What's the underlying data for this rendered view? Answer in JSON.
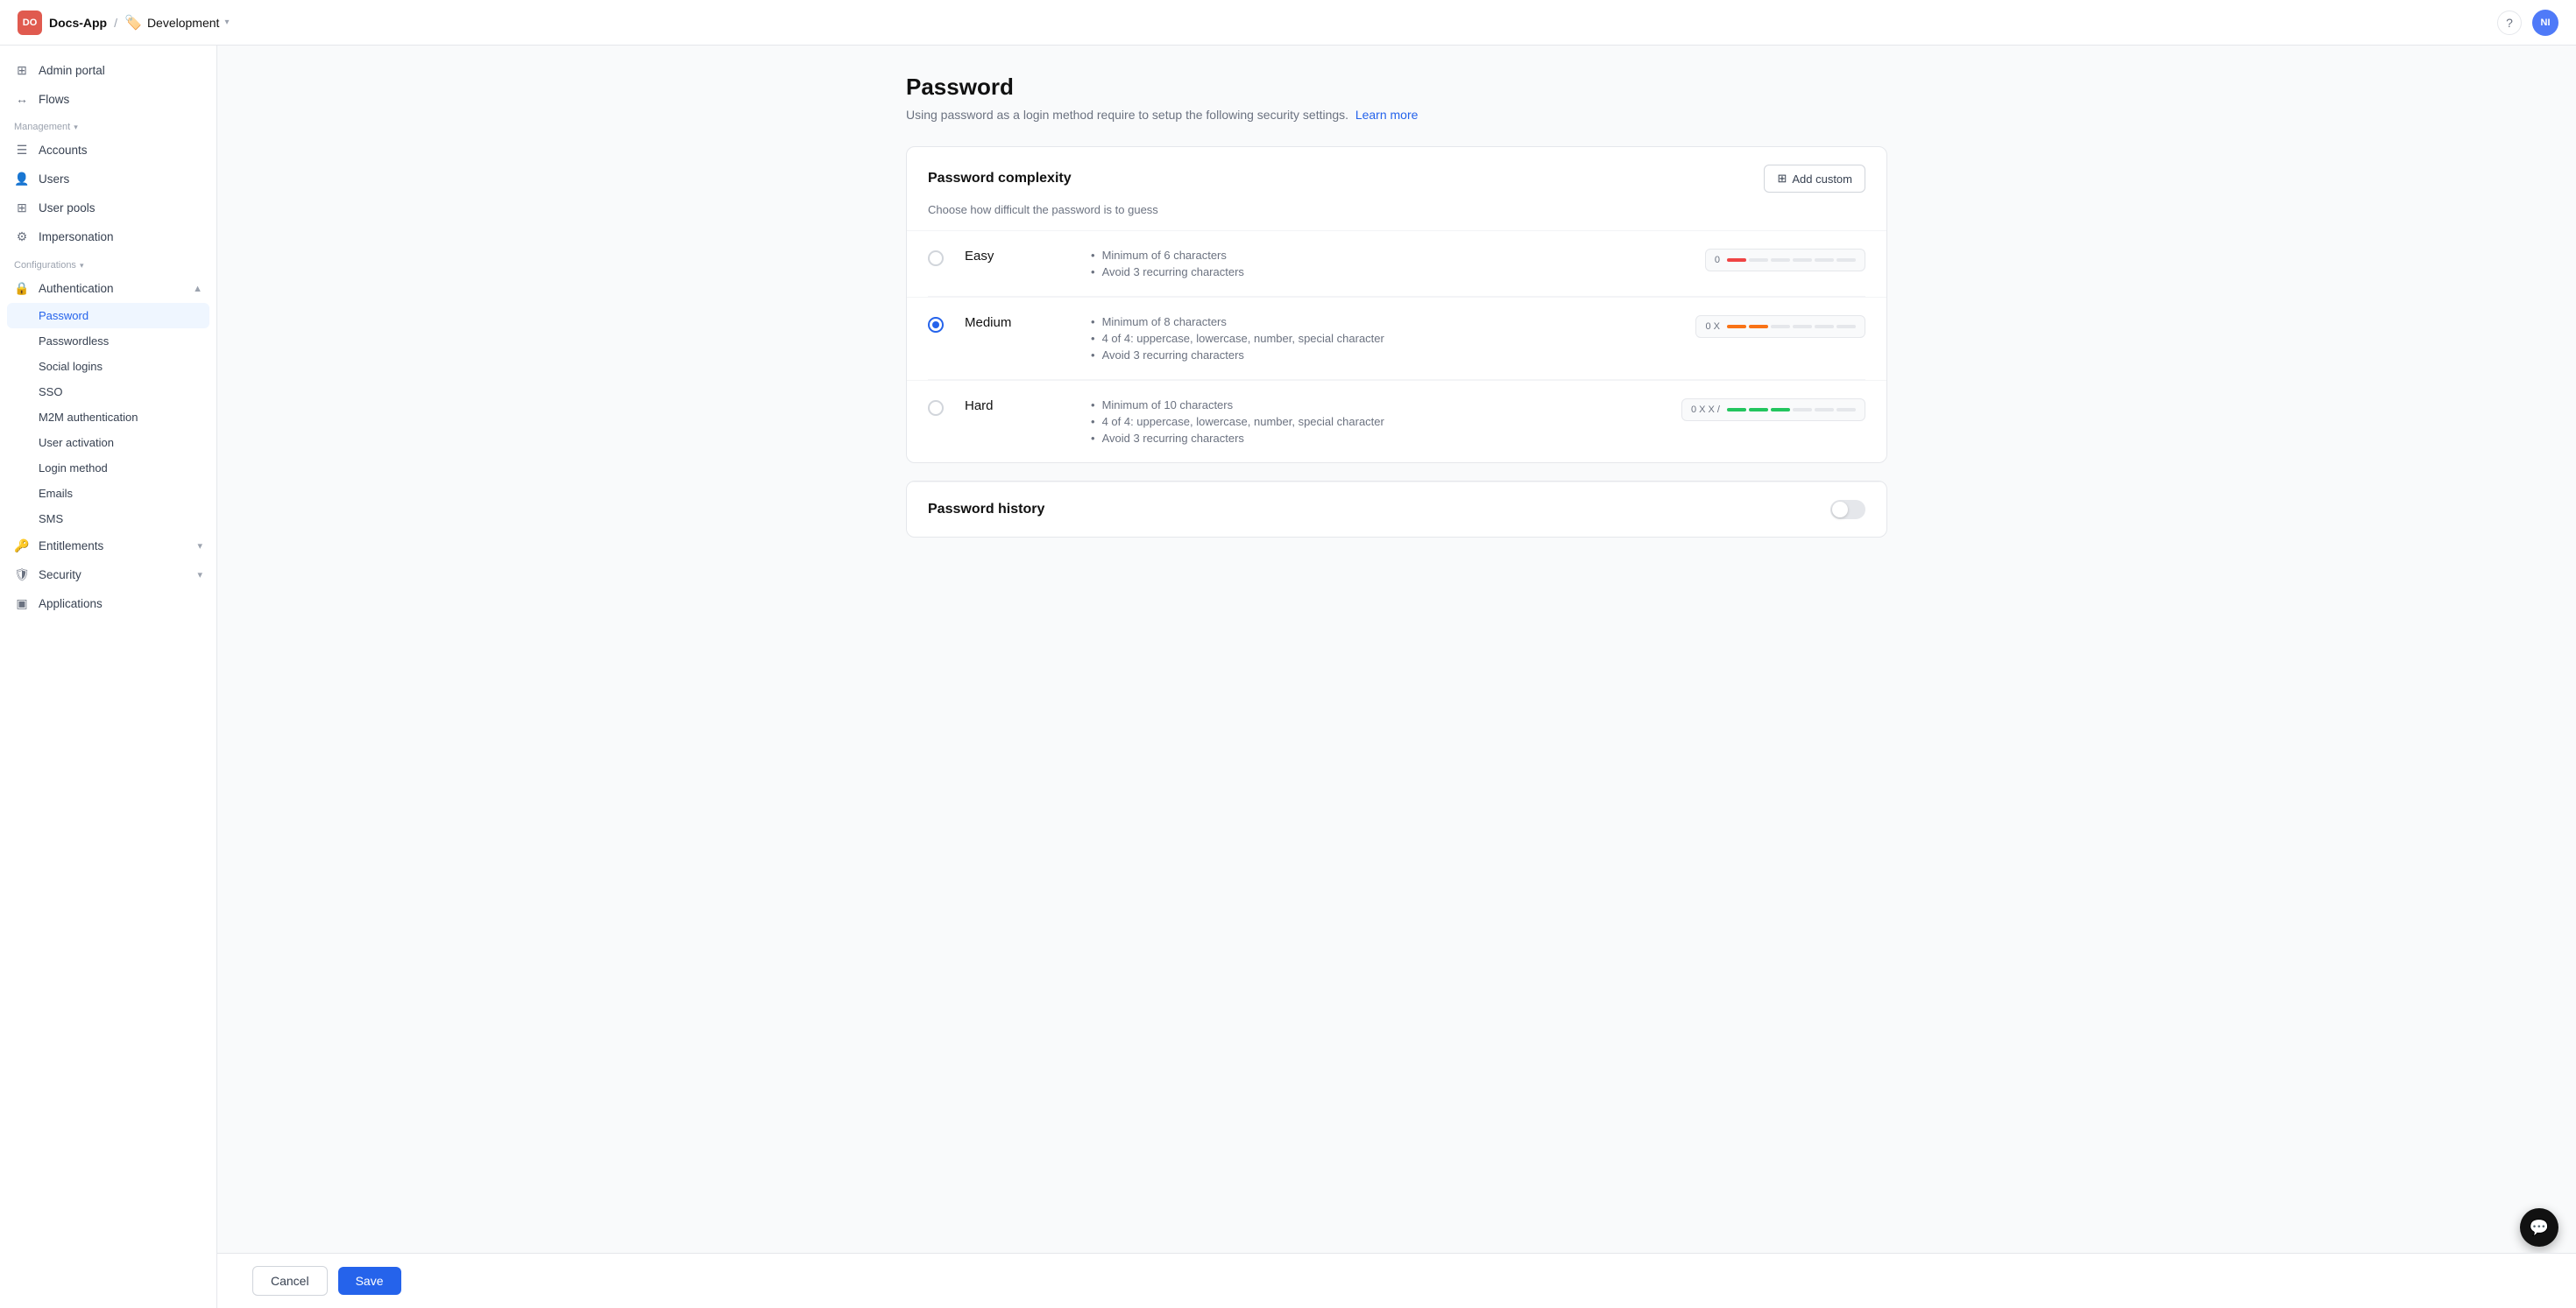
{
  "topbar": {
    "app_logo": "DO",
    "app_name": "Docs-App",
    "separator": "/",
    "env_name": "Development",
    "help_icon": "?",
    "avatar_initials": "NI"
  },
  "sidebar": {
    "admin_portal_label": "Admin portal",
    "flows_label": "Flows",
    "management_label": "Management",
    "accounts_label": "Accounts",
    "users_label": "Users",
    "user_pools_label": "User pools",
    "impersonation_label": "Impersonation",
    "configurations_label": "Configurations",
    "authentication_label": "Authentication",
    "password_label": "Password",
    "passwordless_label": "Passwordless",
    "social_logins_label": "Social logins",
    "sso_label": "SSO",
    "m2m_label": "M2M authentication",
    "user_activation_label": "User activation",
    "login_method_label": "Login method",
    "emails_label": "Emails",
    "sms_label": "SMS",
    "entitlements_label": "Entitlements",
    "security_label": "Security",
    "applications_label": "Applications"
  },
  "page": {
    "title": "Password",
    "description": "Using password as a login method require to setup the following security settings.",
    "learn_more": "Learn more"
  },
  "complexity": {
    "title": "Password complexity",
    "subtitle": "Choose how difficult the password is to guess",
    "add_custom_label": "Add custom",
    "options": [
      {
        "id": "easy",
        "label": "Easy",
        "checked": false,
        "bullets": [
          "Minimum of 6 characters",
          "Avoid 3 recurring characters"
        ],
        "strength_label": "0 · · · · ·",
        "segments": [
          "red",
          "empty",
          "empty",
          "empty",
          "empty",
          "empty"
        ]
      },
      {
        "id": "medium",
        "label": "Medium",
        "checked": true,
        "bullets": [
          "Minimum of 8 characters",
          "4 of 4: uppercase, lowercase, number, special character",
          "Avoid 3 recurring characters"
        ],
        "strength_label": "0 X · · · · · ·",
        "segments": [
          "orange",
          "orange",
          "empty",
          "empty",
          "empty",
          "empty"
        ]
      },
      {
        "id": "hard",
        "label": "Hard",
        "checked": false,
        "bullets": [
          "Minimum of 10 characters",
          "4 of 4: uppercase, lowercase, number, special character",
          "Avoid 3 recurring characters"
        ],
        "strength_label": "0 X X / · · · · · ·",
        "segments": [
          "green",
          "green",
          "green",
          "empty",
          "empty",
          "empty"
        ]
      }
    ]
  },
  "password_history": {
    "title": "Password history"
  },
  "footer": {
    "cancel_label": "Cancel",
    "save_label": "Save"
  }
}
